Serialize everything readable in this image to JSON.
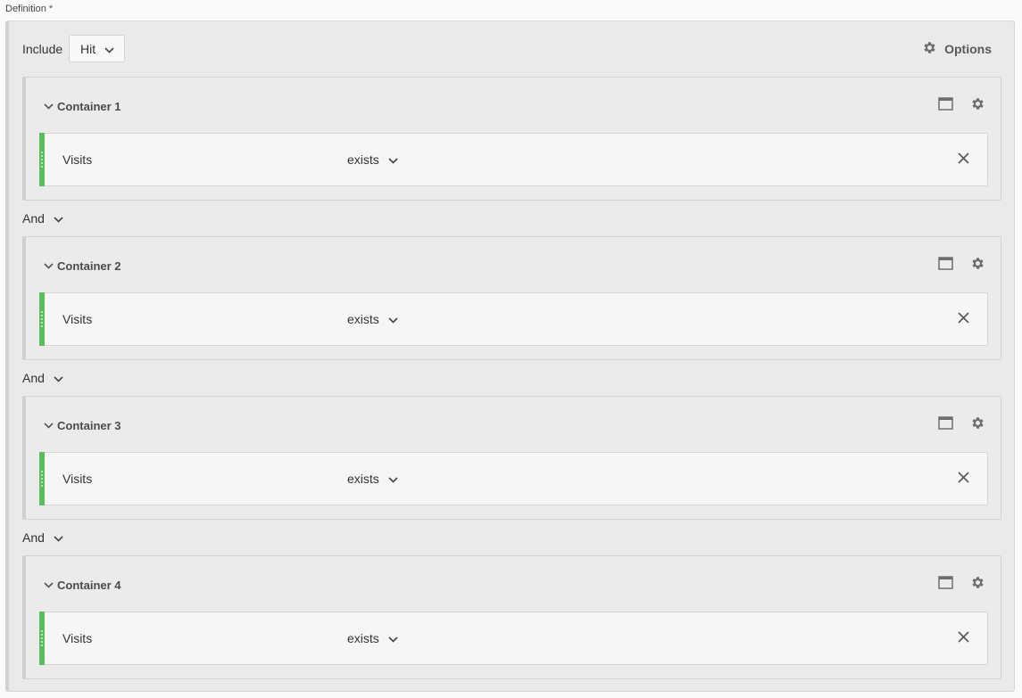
{
  "definition": {
    "label": "Definition",
    "required_marker": "*"
  },
  "top": {
    "include_label": "Include",
    "scope_value": "Hit",
    "options_label": "Options"
  },
  "containers": [
    {
      "title": "Container 1",
      "rule": {
        "dimension": "Visits",
        "operator": "exists"
      }
    },
    {
      "title": "Container 2",
      "rule": {
        "dimension": "Visits",
        "operator": "exists"
      }
    },
    {
      "title": "Container 3",
      "rule": {
        "dimension": "Visits",
        "operator": "exists"
      }
    },
    {
      "title": "Container 4",
      "rule": {
        "dimension": "Visits",
        "operator": "exists"
      }
    }
  ],
  "connectors": [
    {
      "label": "And"
    },
    {
      "label": "And"
    },
    {
      "label": "And"
    }
  ],
  "colors": {
    "rule_accent": "#5bbd5e",
    "panel_bg": "#eaeaea",
    "icon_gray": "#6e6e6e"
  },
  "icons": {
    "scope_dropdown": "chevron-down-icon",
    "options": "gear-icon",
    "container_toggle": "chevron-down-icon",
    "container_view": "window-icon",
    "container_settings": "gear-icon",
    "rule_remove": "close-icon"
  }
}
